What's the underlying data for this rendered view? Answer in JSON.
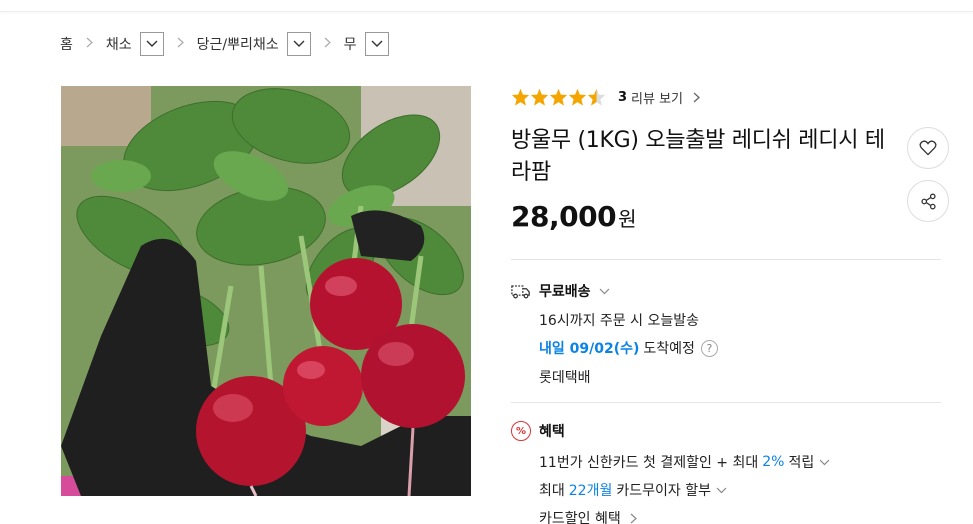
{
  "breadcrumb": {
    "home": "홈",
    "level1": "채소",
    "level2": "당근/뿌리채소",
    "level3": "무"
  },
  "product": {
    "image_icon": "radish-photo",
    "rating_value": 4.5,
    "rating_max": 5,
    "review_count": "3",
    "review_label": "리뷰 보기",
    "title": "방울무 (1KG) 오늘출발 레디쉬 레디시 테라팜",
    "price": "28,000",
    "price_unit": "원"
  },
  "delivery": {
    "icon": "truck-icon",
    "heading": "무료배송",
    "cutoff_text": "16시까지 주문 시 오늘발송",
    "arrival_date": "내일 09/02(수)",
    "arrival_suffix": "도착예정",
    "help_symbol": "?",
    "carrier": "롯데택배"
  },
  "benefits": {
    "icon": "percent-icon",
    "icon_symbol": "%",
    "heading": "혜택",
    "card_discount_prefix": "11번가 신한카드 첫 결제할인 + 최대",
    "card_discount_rate": "2%",
    "card_discount_suffix": "적립",
    "installment_prefix": "최대",
    "installment_months": "22개월",
    "installment_suffix": "카드무이자 할부",
    "card_sale_label": "카드할인 혜택"
  },
  "colors": {
    "accent_blue": "#0b83e6",
    "star": "#f5a500"
  }
}
